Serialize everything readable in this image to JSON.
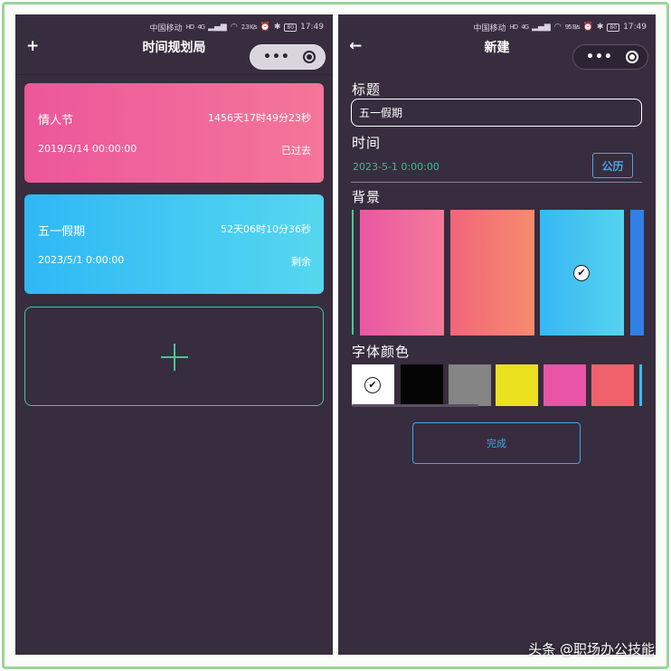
{
  "left": {
    "status": {
      "carrier": "中国移动",
      "hd": "HD",
      "net": "4G",
      "speed": "2.3 K/s",
      "battery": "80",
      "time": "17:49"
    },
    "nav": {
      "add_icon": "+",
      "title": "时间规划局"
    },
    "events": [
      {
        "name": "情人节",
        "count": "1456天17时49分23秒",
        "date": "2019/3/14 00:00:00",
        "state": "已过去",
        "colors": [
          "#ec579a",
          "#f47699"
        ]
      },
      {
        "name": "五一假期",
        "count": "52天06时10分36秒",
        "date": "2023/5/1 0:00:00",
        "state": "剩余",
        "colors": [
          "#2fb8f5",
          "#55d7ef"
        ]
      }
    ],
    "add_card_icon": "plus-icon"
  },
  "right": {
    "status": {
      "carrier": "中国移动",
      "hd": "HD",
      "net": "4G",
      "speed": "95 B/s",
      "battery": "80",
      "time": "17:49"
    },
    "nav": {
      "back_icon": "←",
      "title": "新建"
    },
    "form": {
      "title_label": "标题",
      "title_value": "五一假期",
      "time_label": "时间",
      "time_value": "2023-5-1 0:00:00",
      "calendar_button": "公历",
      "background_label": "背景",
      "font_color_label": "字体颜色",
      "done_button": "完成"
    },
    "backgrounds": [
      {
        "colors": [
          "#e957a3",
          "#f67a9a"
        ],
        "selected": false
      },
      {
        "colors": [
          "#f2667a",
          "#f78a6f"
        ],
        "selected": false
      },
      {
        "colors": [
          "#36b8f4",
          "#57d2ef"
        ],
        "selected": true
      },
      {
        "colors": [
          "#3080e6"
        ],
        "selected": false
      }
    ],
    "font_colors": [
      {
        "color": "#ffffff",
        "selected": true
      },
      {
        "color": "#050505",
        "selected": false
      },
      {
        "color": "#858585",
        "selected": false
      },
      {
        "color": "#ebe11f",
        "selected": false
      },
      {
        "color": "#e954a6",
        "selected": false
      },
      {
        "color": "#f0626b",
        "selected": false
      },
      {
        "color": "#3bb9f0",
        "selected": false
      }
    ],
    "check_mark": "✔"
  },
  "theme": {
    "page_bg": "#372d3e",
    "accent_green": "#49c49a",
    "accent_blue": "#3ba8e6"
  },
  "watermark": "头条 @职场办公技能"
}
